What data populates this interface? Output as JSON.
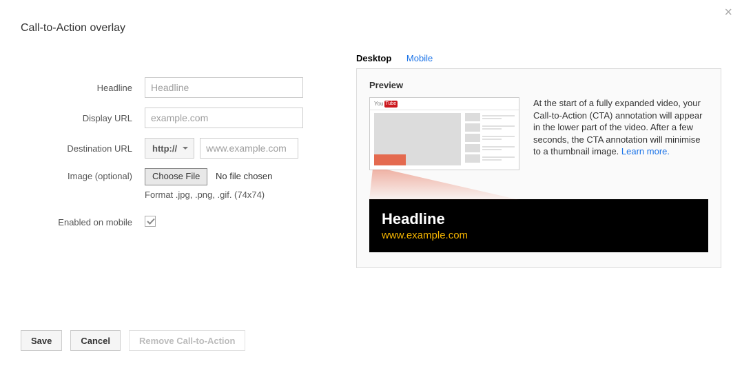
{
  "close_glyph": "×",
  "page_title": "Call-to-Action overlay",
  "form": {
    "headline_label": "Headline",
    "headline_placeholder": "Headline",
    "headline_value": "",
    "display_url_label": "Display URL",
    "display_url_placeholder": "example.com",
    "display_url_value": "",
    "destination_url_label": "Destination URL",
    "protocol_selected": "http://",
    "destination_url_placeholder": "www.example.com",
    "destination_url_value": "",
    "image_label": "Image (optional)",
    "choose_file_label": "Choose File",
    "file_status": "No file chosen",
    "format_hint": "Format .jpg, .png, .gif. (74x74)",
    "enabled_mobile_label": "Enabled on mobile",
    "enabled_mobile_checked": true
  },
  "tabs": {
    "desktop": "Desktop",
    "mobile": "Mobile",
    "active": "desktop"
  },
  "preview": {
    "title": "Preview",
    "description": "At the start of a fully expanded video, your Call-to-Action (CTA) annotation will appear in the lower part of the video. After a few seconds, the CTA annotation will minimise to a thumbnail image. ",
    "learn_more": "Learn more.",
    "cta_headline": "Headline",
    "cta_url": "www.example.com"
  },
  "actions": {
    "save": "Save",
    "cancel": "Cancel",
    "remove": "Remove Call-to-Action"
  }
}
